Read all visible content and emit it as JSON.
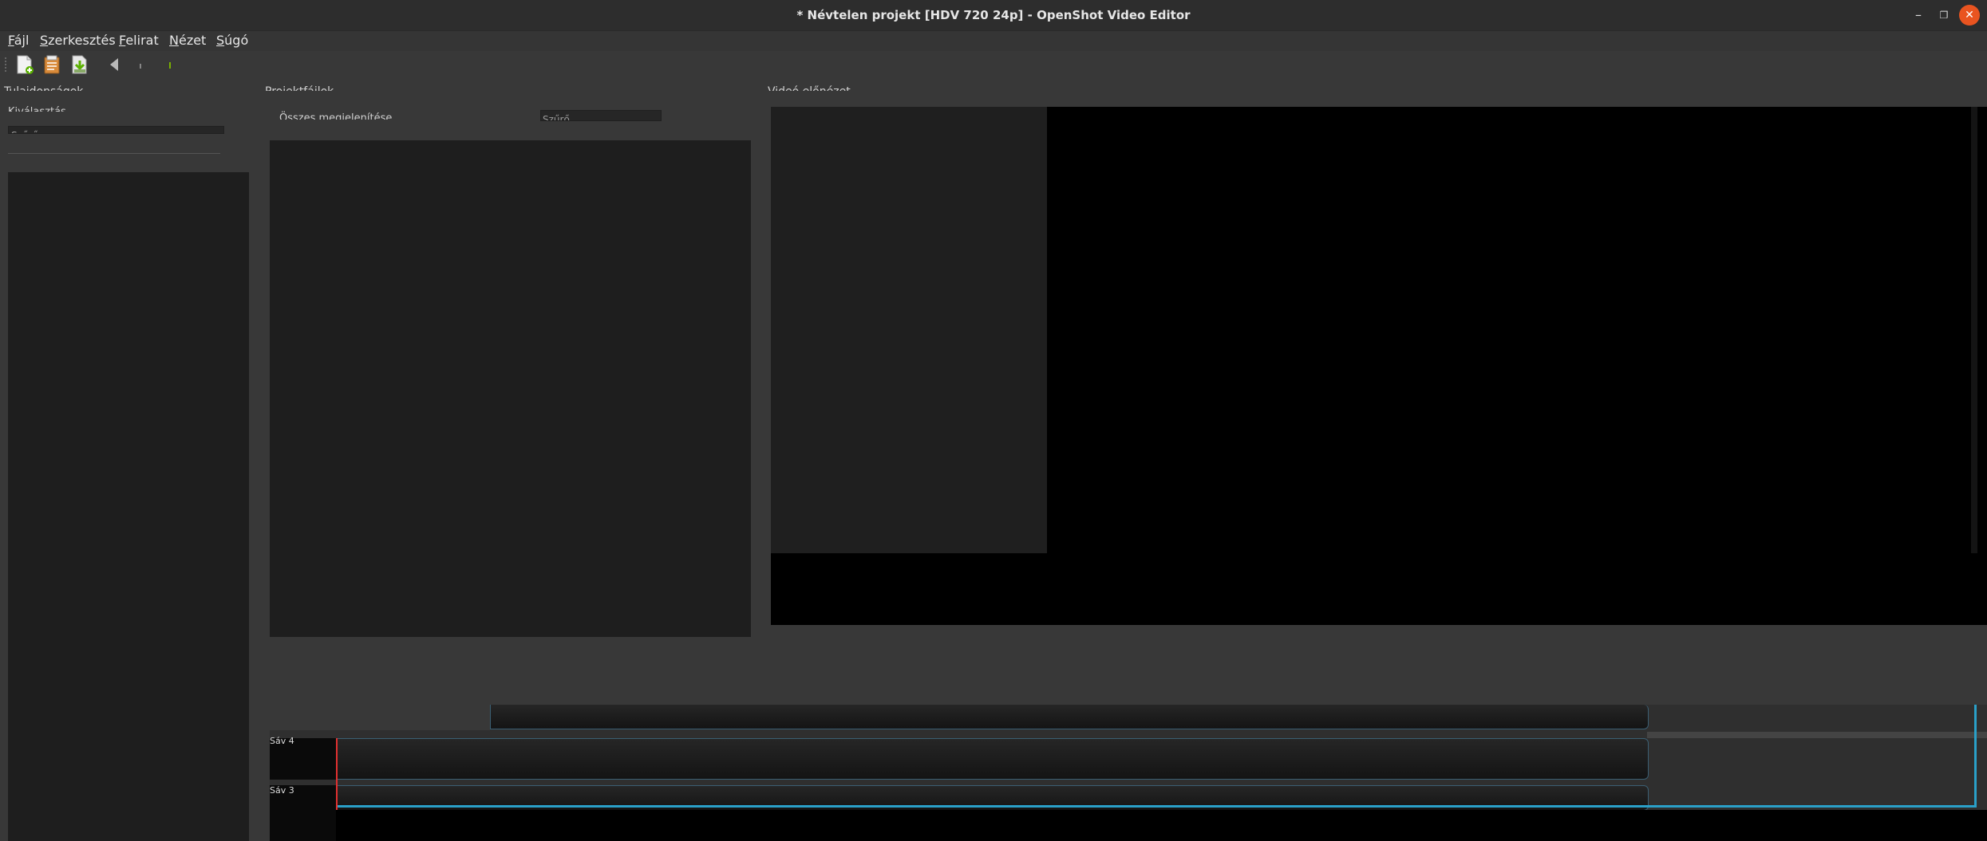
{
  "window": {
    "title": "* Névtelen projekt [HDV 720 24p] - OpenShot Video Editor",
    "minimize_glyph": "–",
    "restore_glyph": "❐",
    "close_glyph": "✕"
  },
  "menu": {
    "items": [
      "Fájl",
      "Szerkesztés",
      "Felirat",
      "Nézet",
      "Súgó"
    ]
  },
  "toolbar": {
    "icons": [
      "new-project-icon",
      "open-project-icon",
      "save-project-icon",
      "undo-icon",
      "redo-icon",
      "export-icon"
    ]
  },
  "docks": {
    "properties": {
      "title": "Tulajdonságok",
      "subtitle": "Kiválasztás",
      "filter_value": "Szűrő"
    },
    "project_files": {
      "title": "Projektfájlok",
      "tab": "Összes megjelenítése",
      "filter_placeholder": "Szűrő"
    },
    "video_preview": {
      "title": "Videó előnézet"
    }
  },
  "timeline": {
    "tracks": [
      {
        "label": "Sáv 4"
      },
      {
        "label": "Sáv 3"
      }
    ]
  },
  "colors": {
    "accent": "#e95420",
    "playhead": "#e03030",
    "track_border": "#3b5f73",
    "timeline_selection": "#2aa0c8"
  }
}
